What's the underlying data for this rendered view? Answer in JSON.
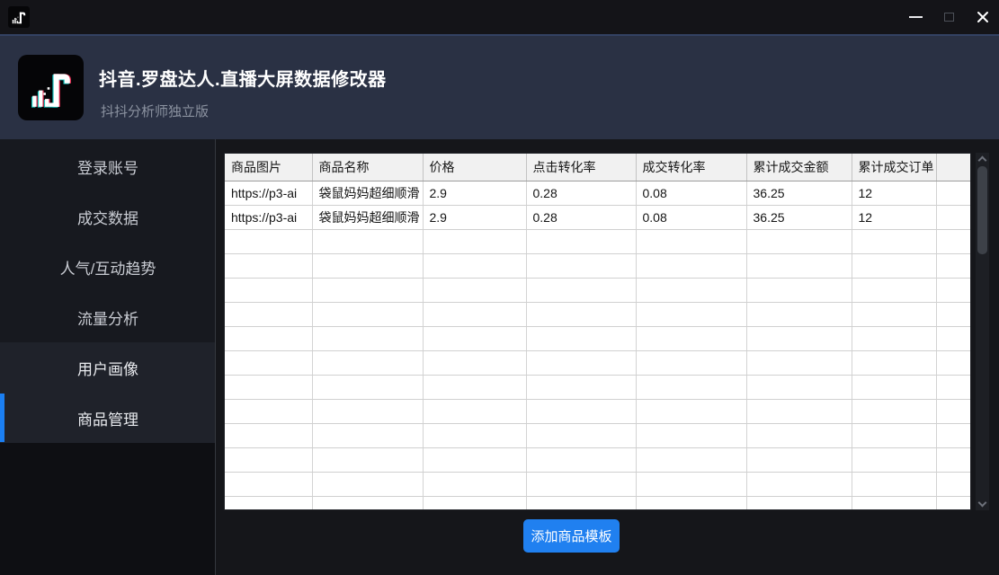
{
  "titlebar": {
    "icons": {
      "app": "app-icon",
      "minimize": "minimize-icon",
      "maximize": "maximize-icon",
      "close": "close-icon"
    }
  },
  "header": {
    "title": "抖音.罗盘达人.直播大屏数据修改器",
    "subtitle": "抖抖分析师独立版",
    "logo_icon": "bar-chart-music-note-logo"
  },
  "sidebar": {
    "items": [
      {
        "label": "登录账号",
        "active": false,
        "group": false
      },
      {
        "label": "成交数据",
        "active": false,
        "group": false
      },
      {
        "label": "人气/互动趋势",
        "active": false,
        "group": false
      },
      {
        "label": "流量分析",
        "active": false,
        "group": false
      },
      {
        "label": "用户画像",
        "active": false,
        "group": true
      },
      {
        "label": "商品管理",
        "active": true,
        "group": true
      }
    ]
  },
  "table": {
    "columns": [
      "商品图片",
      "商品名称",
      "价格",
      "点击转化率",
      "成交转化率",
      "累计成交金额",
      "累计成交订单"
    ],
    "rows": [
      [
        "https://p3-ai",
        "袋鼠妈妈超细顺滑",
        "2.9",
        "0.28",
        "0.08",
        "36.25",
        "12"
      ],
      [
        "https://p3-ai",
        "袋鼠妈妈超细顺滑",
        "2.9",
        "0.28",
        "0.08",
        "36.25",
        "12"
      ]
    ],
    "empty_row_count": 12,
    "scrollbar_icons": [
      "chevron-up-icon",
      "chevron-down-icon"
    ]
  },
  "footer": {
    "add_button_label": "添加商品模板"
  },
  "colors": {
    "accent_blue": "#1b7ff2",
    "button_blue": "#2080f0",
    "header_band": "#2a3144",
    "table_header_bg": "#f1f1f1"
  }
}
